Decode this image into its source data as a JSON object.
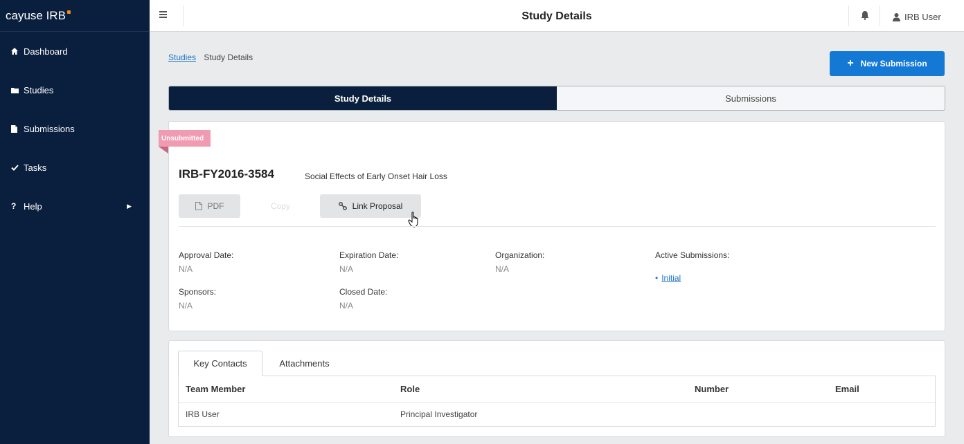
{
  "app": {
    "logo_text": "cayuse IRB"
  },
  "sidebar": {
    "items": [
      {
        "label": "Dashboard",
        "icon": "home-icon"
      },
      {
        "label": "Studies",
        "icon": "folder-icon"
      },
      {
        "label": "Submissions",
        "icon": "file-icon"
      },
      {
        "label": "Tasks",
        "icon": "check-icon"
      },
      {
        "label": "Help",
        "icon": "question-icon"
      }
    ]
  },
  "header": {
    "title": "Study Details",
    "user_name": "IRB User"
  },
  "breadcrumb": {
    "link": "Studies",
    "current": "Study Details"
  },
  "actions": {
    "new_submission": "New Submission"
  },
  "tabs": [
    {
      "label": "Study Details"
    },
    {
      "label": "Submissions"
    }
  ],
  "study": {
    "status_badge": "Unsubmitted",
    "id": "IRB-FY2016-3584",
    "title": "Social Effects of Early Onset Hair Loss",
    "buttons": {
      "pdf": "PDF",
      "copy": "Copy",
      "link_proposal": "Link Proposal"
    },
    "fields": {
      "approval_date": {
        "label": "Approval Date:",
        "value": "N/A"
      },
      "expiration_date": {
        "label": "Expiration Date:",
        "value": "N/A"
      },
      "organization": {
        "label": "Organization:",
        "value": "N/A"
      },
      "active_submissions": {
        "label": "Active Submissions:",
        "items": [
          "Initial"
        ]
      },
      "sponsors": {
        "label": "Sponsors:",
        "value": "N/A"
      },
      "closed_date": {
        "label": "Closed Date:",
        "value": "N/A"
      }
    }
  },
  "contacts": {
    "tabs": [
      "Key Contacts",
      "Attachments"
    ],
    "columns": [
      "Team Member",
      "Role",
      "Number",
      "Email"
    ],
    "rows": [
      {
        "team_member": "IRB User",
        "role": "Principal Investigator",
        "number": "",
        "email": ""
      }
    ]
  },
  "colors": {
    "sidebar_bg": "#0a1f3d",
    "primary": "#1479d4",
    "badge": "#f19bb2",
    "link": "#1f74c8"
  }
}
